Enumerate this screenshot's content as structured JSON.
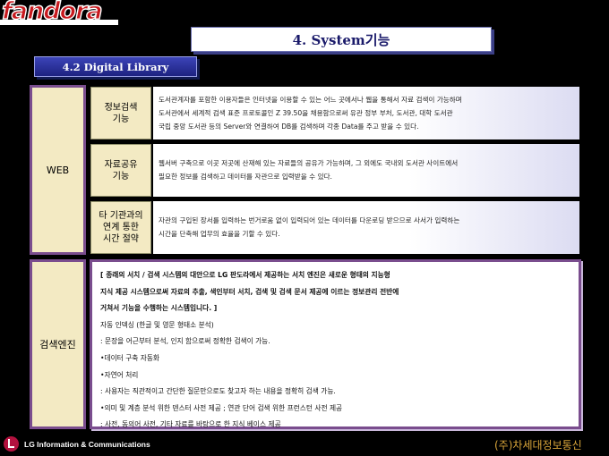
{
  "logo": {
    "text": "fandora"
  },
  "title": "4. System기능",
  "section": "4.2 Digital Library",
  "categories": {
    "web": "WEB",
    "engine": "검색엔진"
  },
  "web_rows": [
    {
      "label_lines": [
        "정보검색",
        "기능"
      ],
      "desc_lines": [
        "도서관계자를 포함한 이용자들은 인터넷을 이용할 수 있는 어느 곳에서나 웹을 통해서 자료 검색이 가능하며",
        "도서관에서 세계적 검색 표준 프로토콜인 Z 39.50을 채용함으로써 유관 정부 부처, 도서관, 대학 도서관",
        "국립 중앙 도서관 등의 Server와 연결하여 DB를 검색하며 각종 Data를 주고 받을 수 있다."
      ]
    },
    {
      "label_lines": [
        "자료공유",
        "기능"
      ],
      "desc_lines": [
        "웹서버 구축으로 이곳 저곳에 산재해 있는 자료들의 공유가 가능하며, 그 외에도 국내외 도서관 사이트에서",
        "필요한 정보를 검색하고 데이터를 자관으로 입력받을 수 있다."
      ]
    },
    {
      "label_lines": [
        "타 기관과의",
        "연계 통한",
        "시간 절약"
      ],
      "desc_lines": [
        "자관의 구입된 장서를 입력하는 번거로움 없이 입력되어 있는 데이터를 다운로딩 받으므로 사서가 입력하는",
        "시간을 단축해 업무의 효율을 기할 수 있다."
      ]
    }
  ],
  "engine_lines": [
    {
      "text": "[ 종래의 서치 / 검색  시스템의 대안으로 LG 판도라에서 제공하는 서치 엔진은 새로운 형태의 지능형",
      "bold": true
    },
    {
      "text": "  지식 제공 시스템으로써 자료의 추출, 색인부터 서치, 검색 및 검색 문서 제공에 이르는 정보관리 전반에",
      "bold": true
    },
    {
      "text": "  거쳐서 기능을 수행하는 시스템입니다. ]",
      "bold": true
    },
    {
      "text": " 자동 인덱싱 (한글 및 영문 형태소 분석)",
      "bold": false
    },
    {
      "text": "    : 문장을 어근부터 분석, 인지 함으로써 정확한 검색이 가능.",
      "bold": false
    },
    {
      "text": "•데이터 구축 자동화",
      "bold": false
    },
    {
      "text": "•자연어 처리",
      "bold": false
    },
    {
      "text": "    : 사용자는 직관적이고 간단한 질문만으로도 찾고자 하는 내용을 정확히 검색 가능.",
      "bold": false
    },
    {
      "text": "•의미 및 계층 분석 위한 덴스터 사전 제공 ; 연관 단어 검색 위한 프런스턴 사전 제공",
      "bold": false
    },
    {
      "text": "    : 사전, 동의어 사전, 기타 자료를 바탕으로  한 지식 베이스 제공",
      "bold": false
    }
  ],
  "footer": {
    "lg_text": "LG Information & Communications",
    "company": "(주)차세대정보통신"
  },
  "colors": {
    "border_purple": "#7a4d8e",
    "label_fill": "#f3eac3",
    "section_blue": "#2a30a0",
    "logo_red": "#c8191e"
  }
}
